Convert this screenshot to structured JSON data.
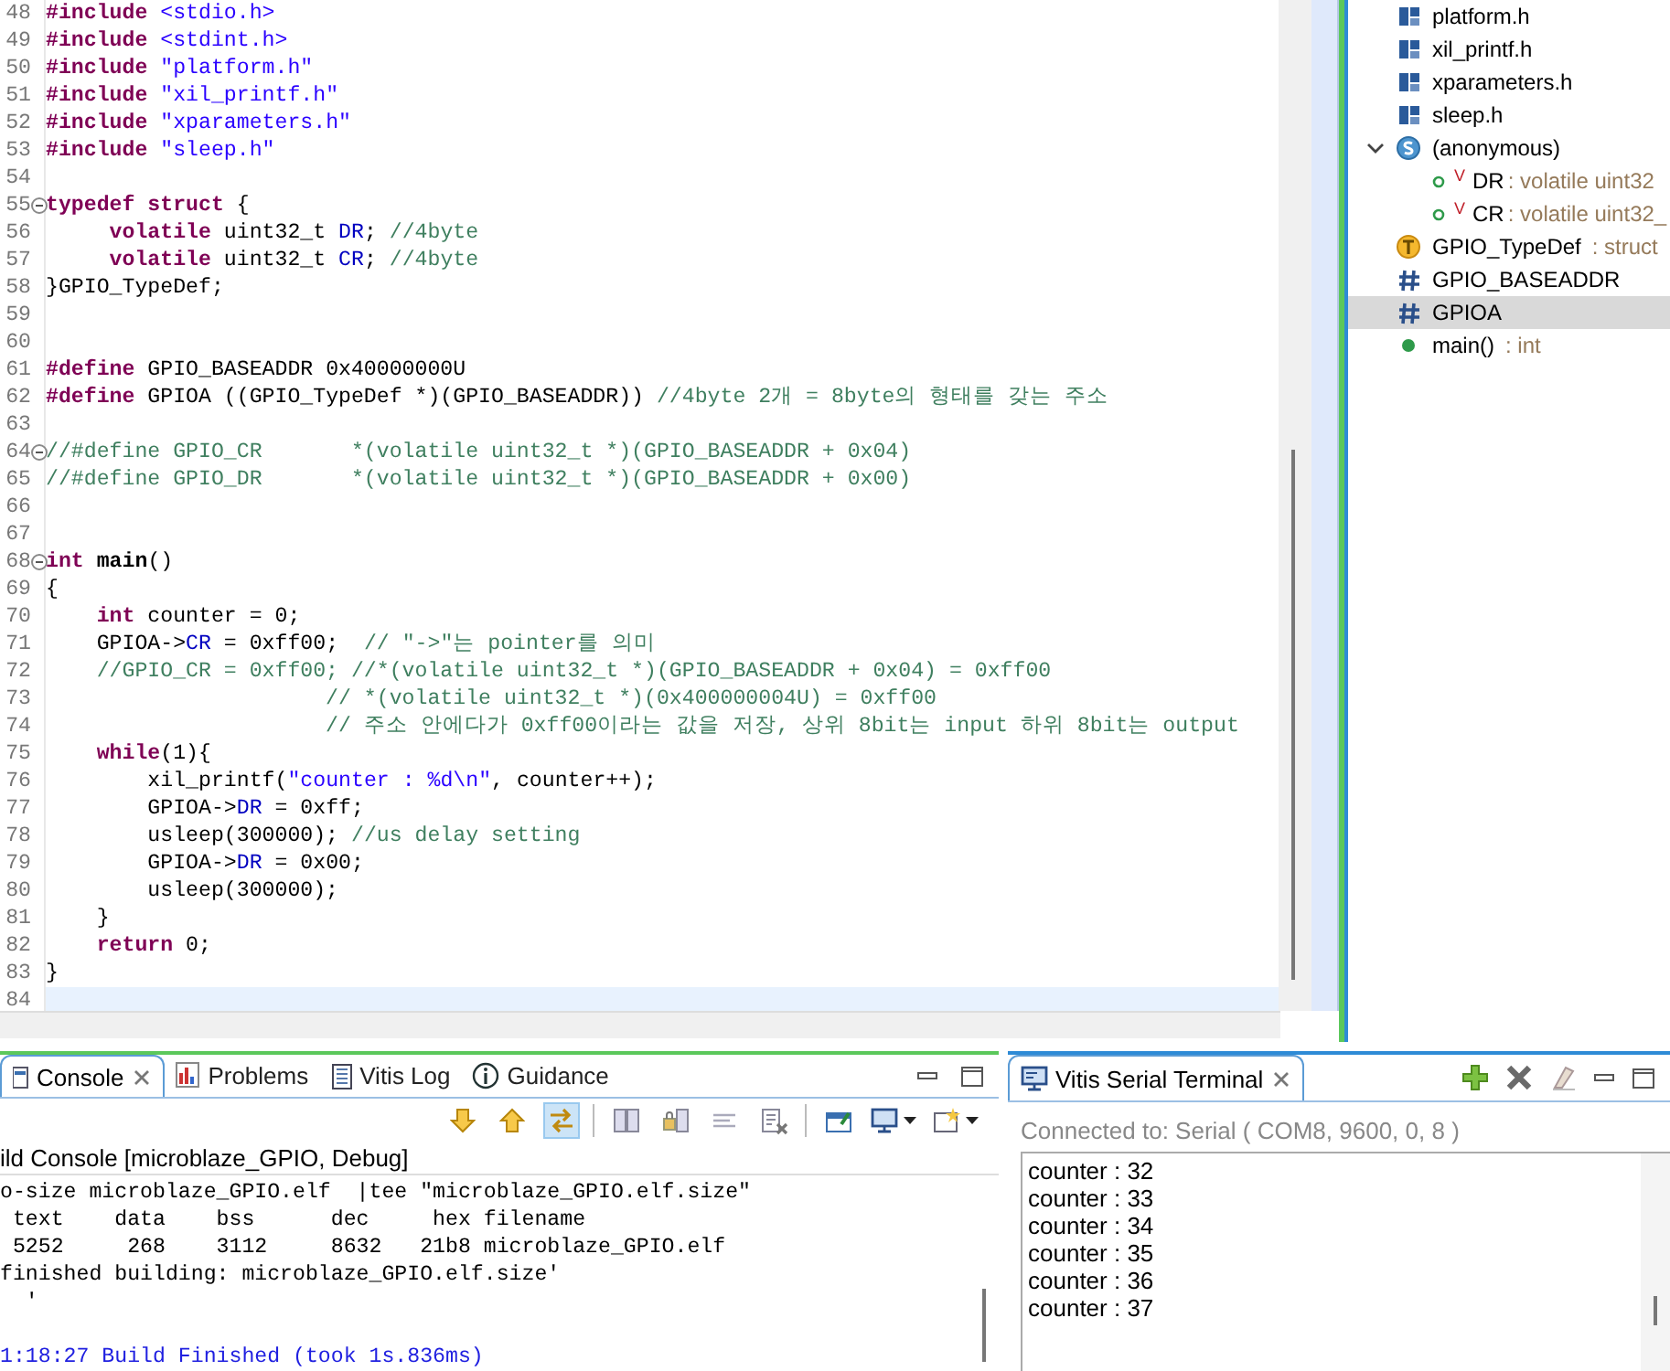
{
  "editor": {
    "lines": [
      {
        "number": "48",
        "fold": false,
        "current": false,
        "tokens": [
          {
            "kind": "pre",
            "text": "#include "
          },
          {
            "kind": "str",
            "text": "<stdio.h>"
          }
        ]
      },
      {
        "number": "49",
        "fold": false,
        "current": false,
        "tokens": [
          {
            "kind": "pre",
            "text": "#include "
          },
          {
            "kind": "str",
            "text": "<stdint.h>"
          }
        ]
      },
      {
        "number": "50",
        "fold": false,
        "current": false,
        "tokens": [
          {
            "kind": "pre",
            "text": "#include "
          },
          {
            "kind": "str",
            "text": "\"platform.h\""
          }
        ]
      },
      {
        "number": "51",
        "fold": false,
        "current": false,
        "tokens": [
          {
            "kind": "pre",
            "text": "#include "
          },
          {
            "kind": "str",
            "text": "\"xil_printf.h\""
          }
        ]
      },
      {
        "number": "52",
        "fold": false,
        "current": false,
        "tokens": [
          {
            "kind": "pre",
            "text": "#include "
          },
          {
            "kind": "str",
            "text": "\"xparameters.h\""
          }
        ]
      },
      {
        "number": "53",
        "fold": false,
        "current": false,
        "tokens": [
          {
            "kind": "pre",
            "text": "#include "
          },
          {
            "kind": "str",
            "text": "\"sleep.h\""
          }
        ]
      },
      {
        "number": "54",
        "fold": false,
        "current": false
      },
      {
        "number": "55",
        "fold": true,
        "current": false,
        "tokens": [
          {
            "kind": "kw",
            "text": "typedef struct"
          },
          {
            "kind": "plain",
            "text": " {"
          }
        ]
      },
      {
        "number": "56",
        "fold": false,
        "current": false,
        "tokens": [
          {
            "kind": "kw",
            "text": "     volatile"
          },
          {
            "kind": "plain",
            "text": " uint32_t "
          },
          {
            "kind": "field",
            "text": "DR"
          },
          {
            "kind": "plain",
            "text": "; "
          },
          {
            "kind": "com",
            "text": "//4byte"
          }
        ]
      },
      {
        "number": "57",
        "fold": false,
        "current": false,
        "tokens": [
          {
            "kind": "kw",
            "text": "     volatile"
          },
          {
            "kind": "plain",
            "text": " uint32_t "
          },
          {
            "kind": "field",
            "text": "CR"
          },
          {
            "kind": "plain",
            "text": "; "
          },
          {
            "kind": "com",
            "text": "//4byte"
          }
        ]
      },
      {
        "number": "58",
        "fold": false,
        "current": false,
        "tokens": [
          {
            "kind": "plain",
            "text": "}GPIO_TypeDef;"
          }
        ]
      },
      {
        "number": "59",
        "fold": false,
        "current": false
      },
      {
        "number": "60",
        "fold": false,
        "current": false
      },
      {
        "number": "61",
        "fold": false,
        "current": false,
        "tokens": [
          {
            "kind": "pre",
            "text": "#define"
          },
          {
            "kind": "plain",
            "text": " GPIO_BASEADDR 0x40000000U"
          }
        ]
      },
      {
        "number": "62",
        "fold": false,
        "current": false,
        "tokens": [
          {
            "kind": "pre",
            "text": "#define"
          },
          {
            "kind": "plain",
            "text": " GPIOA ((GPIO_TypeDef *)(GPIO_BASEADDR)) "
          },
          {
            "kind": "com",
            "text": "//4byte 2개 = 8byte의 형태를 갖는 주소"
          }
        ]
      },
      {
        "number": "63",
        "fold": false,
        "current": false
      },
      {
        "number": "64",
        "fold": true,
        "current": false,
        "tokens": [
          {
            "kind": "com",
            "text": "//#define GPIO_CR       *(volatile uint32_t *)(GPIO_BASEADDR + 0x04)"
          }
        ]
      },
      {
        "number": "65",
        "fold": false,
        "current": false,
        "tokens": [
          {
            "kind": "com",
            "text": "//#define GPIO_DR       *(volatile uint32_t *)(GPIO_BASEADDR + 0x00)"
          }
        ]
      },
      {
        "number": "66",
        "fold": false,
        "current": false
      },
      {
        "number": "67",
        "fold": false,
        "current": false
      },
      {
        "number": "68",
        "fold": true,
        "current": false,
        "tokens": [
          {
            "kind": "kw",
            "text": "int "
          },
          {
            "kind": "func",
            "text": "main"
          },
          {
            "kind": "plain",
            "text": "()"
          }
        ]
      },
      {
        "number": "69",
        "fold": false,
        "current": false,
        "tokens": [
          {
            "kind": "plain",
            "text": "{"
          }
        ]
      },
      {
        "number": "70",
        "fold": false,
        "current": false,
        "tokens": [
          {
            "kind": "kw",
            "text": "    int"
          },
          {
            "kind": "plain",
            "text": " counter = 0;"
          }
        ]
      },
      {
        "number": "71",
        "fold": false,
        "current": false,
        "tokens": [
          {
            "kind": "plain",
            "text": "    GPIOA->"
          },
          {
            "kind": "field",
            "text": "CR"
          },
          {
            "kind": "plain",
            "text": " = 0xff00;  "
          },
          {
            "kind": "com",
            "text": "// \"->\"는 pointer를 의미"
          }
        ]
      },
      {
        "number": "72",
        "fold": false,
        "current": false,
        "tokens": [
          {
            "kind": "com",
            "text": "    //GPIO_CR = 0xff00; //*(volatile uint32_t *)(GPIO_BASEADDR + 0x04) = 0xff00"
          }
        ]
      },
      {
        "number": "73",
        "fold": false,
        "current": false,
        "tokens": [
          {
            "kind": "com",
            "text": "                      // *(volatile uint32_t *)(0x400000004U) = 0xff00"
          }
        ]
      },
      {
        "number": "74",
        "fold": false,
        "current": false,
        "tokens": [
          {
            "kind": "com",
            "text": "                      // 주소 안에다가 0xff00이라는 값을 저장, 상위 8bit는 input 하위 8bit는 output"
          }
        ]
      },
      {
        "number": "75",
        "fold": false,
        "current": false,
        "tokens": [
          {
            "kind": "kw",
            "text": "    while"
          },
          {
            "kind": "plain",
            "text": "(1){"
          }
        ]
      },
      {
        "number": "76",
        "fold": false,
        "current": false,
        "tokens": [
          {
            "kind": "plain",
            "text": "        xil_printf("
          },
          {
            "kind": "str",
            "text": "\"counter : %d\\n\""
          },
          {
            "kind": "plain",
            "text": ", counter++);"
          }
        ]
      },
      {
        "number": "77",
        "fold": false,
        "current": false,
        "tokens": [
          {
            "kind": "plain",
            "text": "        GPIOA->"
          },
          {
            "kind": "field",
            "text": "DR"
          },
          {
            "kind": "plain",
            "text": " = 0xff;"
          }
        ]
      },
      {
        "number": "78",
        "fold": false,
        "current": false,
        "tokens": [
          {
            "kind": "plain",
            "text": "        usleep(300000); "
          },
          {
            "kind": "com",
            "text": "//us delay setting"
          }
        ]
      },
      {
        "number": "79",
        "fold": false,
        "current": false,
        "tokens": [
          {
            "kind": "plain",
            "text": "        GPIOA->"
          },
          {
            "kind": "field",
            "text": "DR"
          },
          {
            "kind": "plain",
            "text": " = 0x00;"
          }
        ]
      },
      {
        "number": "80",
        "fold": false,
        "current": false,
        "tokens": [
          {
            "kind": "plain",
            "text": "        usleep(300000);"
          }
        ]
      },
      {
        "number": "81",
        "fold": false,
        "current": false,
        "tokens": [
          {
            "kind": "plain",
            "text": "    }"
          }
        ]
      },
      {
        "number": "82",
        "fold": false,
        "current": false,
        "tokens": [
          {
            "kind": "kw",
            "text": "    return"
          },
          {
            "kind": "plain",
            "text": " 0;"
          }
        ]
      },
      {
        "number": "83",
        "fold": false,
        "current": false,
        "tokens": [
          {
            "kind": "plain",
            "text": "}"
          }
        ]
      },
      {
        "number": "84",
        "fold": false,
        "current": true
      }
    ]
  },
  "outline": {
    "items": [
      {
        "kind": "include",
        "name": "platform.h",
        "selected": false
      },
      {
        "kind": "include",
        "name": "xil_printf.h",
        "selected": false
      },
      {
        "kind": "include",
        "name": "xparameters.h",
        "selected": false
      },
      {
        "kind": "include",
        "name": "sleep.h",
        "selected": false
      },
      {
        "kind": "struct",
        "name": "(anonymous)",
        "selected": false,
        "expanded": true,
        "children": [
          {
            "kind": "field",
            "modifier": "V",
            "name": "DR",
            "detail": ": volatile uint32",
            "selected": false
          },
          {
            "kind": "field",
            "modifier": "V",
            "name": "CR",
            "detail": ": volatile uint32_",
            "selected": false
          }
        ]
      },
      {
        "kind": "typedef",
        "name": "GPIO_TypeDef",
        "detail": ": struct",
        "selected": false
      },
      {
        "kind": "macro",
        "name": "GPIO_BASEADDR",
        "selected": false
      },
      {
        "kind": "macro",
        "name": "GPIOA",
        "selected": true
      },
      {
        "kind": "function",
        "name": "main()",
        "detail": ": int",
        "selected": false
      }
    ]
  },
  "console": {
    "tabs": [
      {
        "label": "Console",
        "selected": true,
        "closable": true
      },
      {
        "label": "Problems",
        "selected": false,
        "closable": false
      },
      {
        "label": "Vitis Log",
        "selected": false,
        "closable": false
      },
      {
        "label": "Guidance",
        "selected": false,
        "closable": false
      }
    ],
    "toggle_on": true,
    "header": "ild Console [microblaze_GPIO, Debug]",
    "lines": [
      {
        "kind": "output",
        "text": "o-size microblaze_GPIO.elf  |tee \"microblaze_GPIO.elf.size\""
      },
      {
        "kind": "output",
        "text": " text    data    bss      dec     hex filename"
      },
      {
        "kind": "output",
        "text": " 5252     268    3112     8632   21b8 microblaze_GPIO.elf"
      },
      {
        "kind": "output",
        "text": "finished building: microblaze_GPIO.elf.size'"
      },
      {
        "kind": "output",
        "text": "  '"
      },
      {
        "kind": "blank"
      },
      {
        "kind": "status",
        "text": "1:18:27 Build Finished (took 1s.836ms)"
      }
    ]
  },
  "serial": {
    "tab": {
      "label": "Vitis Serial Terminal",
      "selected": true
    },
    "connection": "Connected to: Serial (  COM8, 9600, 0, 8 )",
    "lines": [
      "counter : 32",
      "counter : 33",
      "counter : 34",
      "counter : 35",
      "counter : 36",
      "counter : 37"
    ]
  }
}
